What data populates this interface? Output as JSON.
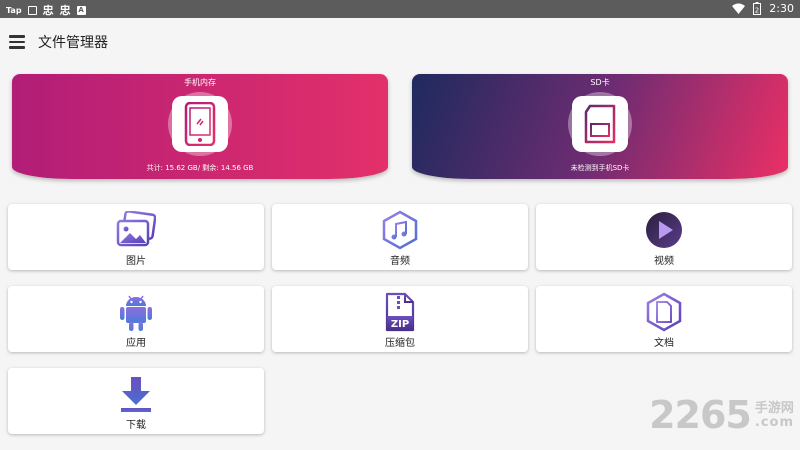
{
  "status_bar": {
    "tap_label": "Tap",
    "glyph1": "忠",
    "glyph2": "忠",
    "a_badge": "A",
    "battery_level": "2",
    "time": "2:30"
  },
  "app_bar": {
    "title": "文件管理器"
  },
  "storage": [
    {
      "label": "手机内存",
      "detail": "共计: 15.62 GB/ 剩余: 14.56 GB",
      "icon": "phone-icon"
    },
    {
      "label": "SD卡",
      "detail": "未检测到手机SD卡",
      "icon": "sd-card-icon"
    }
  ],
  "categories": [
    {
      "label": "图片",
      "icon": "image-icon"
    },
    {
      "label": "音频",
      "icon": "music-icon"
    },
    {
      "label": "视频",
      "icon": "video-play-icon"
    },
    {
      "label": "应用",
      "icon": "android-icon"
    },
    {
      "label": "压缩包",
      "icon": "zip-icon"
    },
    {
      "label": "文档",
      "icon": "document-icon"
    },
    {
      "label": "下载",
      "icon": "download-icon"
    }
  ],
  "watermark": {
    "number": "2265",
    "brand": "手游网",
    "domain": ".com"
  },
  "colors": {
    "phone_card_start": "#b21d77",
    "phone_card_end": "#e3306a",
    "sd_card_start": "#1e2a5e",
    "sd_card_end": "#ec2f66",
    "icon_purple": "#7b5cd6",
    "status_bar": "#5c5c5c"
  }
}
